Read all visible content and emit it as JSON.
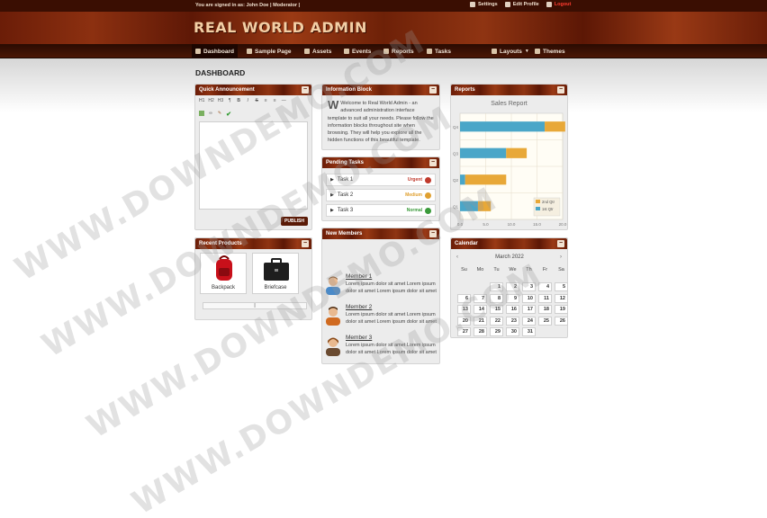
{
  "topbar": {
    "signed_in": "You are signed in as: John Doe | Moderator |",
    "links": [
      "Settings",
      "Edit Profile",
      "Logout"
    ]
  },
  "app_title": "REAL WORLD ADMIN",
  "nav": {
    "items": [
      "Dashboard",
      "Sample Page",
      "Assets",
      "Events",
      "Reports",
      "Tasks"
    ],
    "right_items": [
      "Layouts",
      "Themes"
    ]
  },
  "page_title": "DASHBOARD",
  "announcement": {
    "title": "Quick Announcement",
    "toolbar": [
      "H1",
      "H2",
      "H3",
      "¶",
      "B",
      "I",
      "S",
      "≡",
      "≡",
      "—"
    ],
    "publish": "PUBLISH"
  },
  "info_block": {
    "title": "Information Block",
    "text": "Welcome to Real World Admin - an advanced administration interface template to suit all your needs. Please follow the information blocks throughout site when browsing. They will help you explore all the hidden functions of this beautiful template."
  },
  "pending_tasks": {
    "title": "Pending Tasks",
    "items": [
      {
        "label": "Task 1",
        "status": "Urgent",
        "color": "#c0392b"
      },
      {
        "label": "Task 2",
        "status": "Medium",
        "color": "#e0a030"
      },
      {
        "label": "Task 3",
        "status": "Normal",
        "color": "#3a9a3a"
      }
    ]
  },
  "new_members": {
    "title": "New Members",
    "members": [
      {
        "name": "Member 1",
        "text": "Lorem ipsum dolor sit amet Lorem ipsum dolor sit amet Lorem ipsum dolor sit amet"
      },
      {
        "name": "Member 2",
        "text": "Lorem ipsum dolor sit amet Lorem ipsum dolor sit amet Lorem ipsum dolor sit amet"
      },
      {
        "name": "Member 3",
        "text": "Lorem ipsum dolor sit amet Lorem ipsum dolor sit amet Lorem ipsum dolor sit amet"
      }
    ]
  },
  "recent_products": {
    "title": "Recent Products",
    "items": [
      "Backpack",
      "Briefcase"
    ]
  },
  "reports": {
    "title": "Reports"
  },
  "chart_data": {
    "type": "bar",
    "orientation": "horizontal",
    "stacked": true,
    "title": "Sales Report",
    "categories": [
      "Q1",
      "Q2",
      "Q3",
      "Q4"
    ],
    "series": [
      {
        "name": "1st Qtr",
        "values": [
          3.5,
          1,
          9,
          16.5
        ],
        "color": "#4aa6c8"
      },
      {
        "name": "2nd Qtr",
        "values": [
          2.5,
          8,
          4,
          4
        ],
        "color": "#e8a838"
      }
    ],
    "xlim": [
      0,
      20
    ],
    "xticks": [
      "0.0",
      "5.0",
      "10.0",
      "15.0",
      "20.0"
    ],
    "grid": true,
    "legend": "bottom-right"
  },
  "calendar": {
    "title": "Calendar",
    "month": "March 2022",
    "dow": [
      "Su",
      "Mo",
      "Tu",
      "We",
      "Th",
      "Fr",
      "Sa"
    ],
    "days": [
      "1",
      "2",
      "3",
      "4",
      "5",
      "6",
      "7",
      "8",
      "9",
      "10",
      "11",
      "12",
      "13",
      "14",
      "15",
      "16",
      "17",
      "18",
      "19",
      "20",
      "21",
      "22",
      "23",
      "24",
      "25",
      "26",
      "27",
      "28",
      "29",
      "30",
      "31"
    ]
  },
  "watermark": "WWW.DOWNDEMO.COM"
}
